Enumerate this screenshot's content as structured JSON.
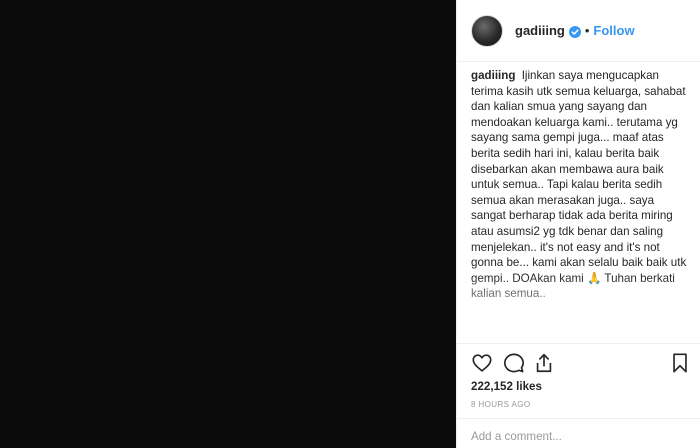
{
  "post": {
    "username": "gadiiing",
    "separator": "•",
    "follow_label": "Follow",
    "caption_user": "gadiiing",
    "caption_text": "Ijinkan saya mengucapkan terima kasih utk semua keluarga, sahabat dan kalian smua yang sayang dan mendoakan keluarga kami.. terutama yg sayang sama gempi juga... maaf atas berita sedih hari ini, kalau berita baik disebarkan akan membawa aura baik untuk semua.. Tapi kalau berita sedih semua akan merasakan juga.. saya sangat berharap tidak ada berita miring atau asumsi2 yg tdk benar dan saling menjelekan.. it's not easy and it's not gonna be... kami akan selalu baik baik utk gempi.. DOAkan kami 🙏 Tuhan berkati kalian semua..",
    "likes_count": "222,152",
    "likes_label": "likes",
    "timestamp": "8 HOURS AGO"
  },
  "comment": {
    "placeholder": "Add a comment..."
  },
  "icons": {
    "verified": "verified-badge-icon",
    "like": "heart-icon",
    "comment": "comment-icon",
    "share": "share-icon",
    "save": "bookmark-icon"
  },
  "colors": {
    "accent": "#3897f0",
    "media_background": "#0b0b0b",
    "muted_text": "#999999"
  }
}
